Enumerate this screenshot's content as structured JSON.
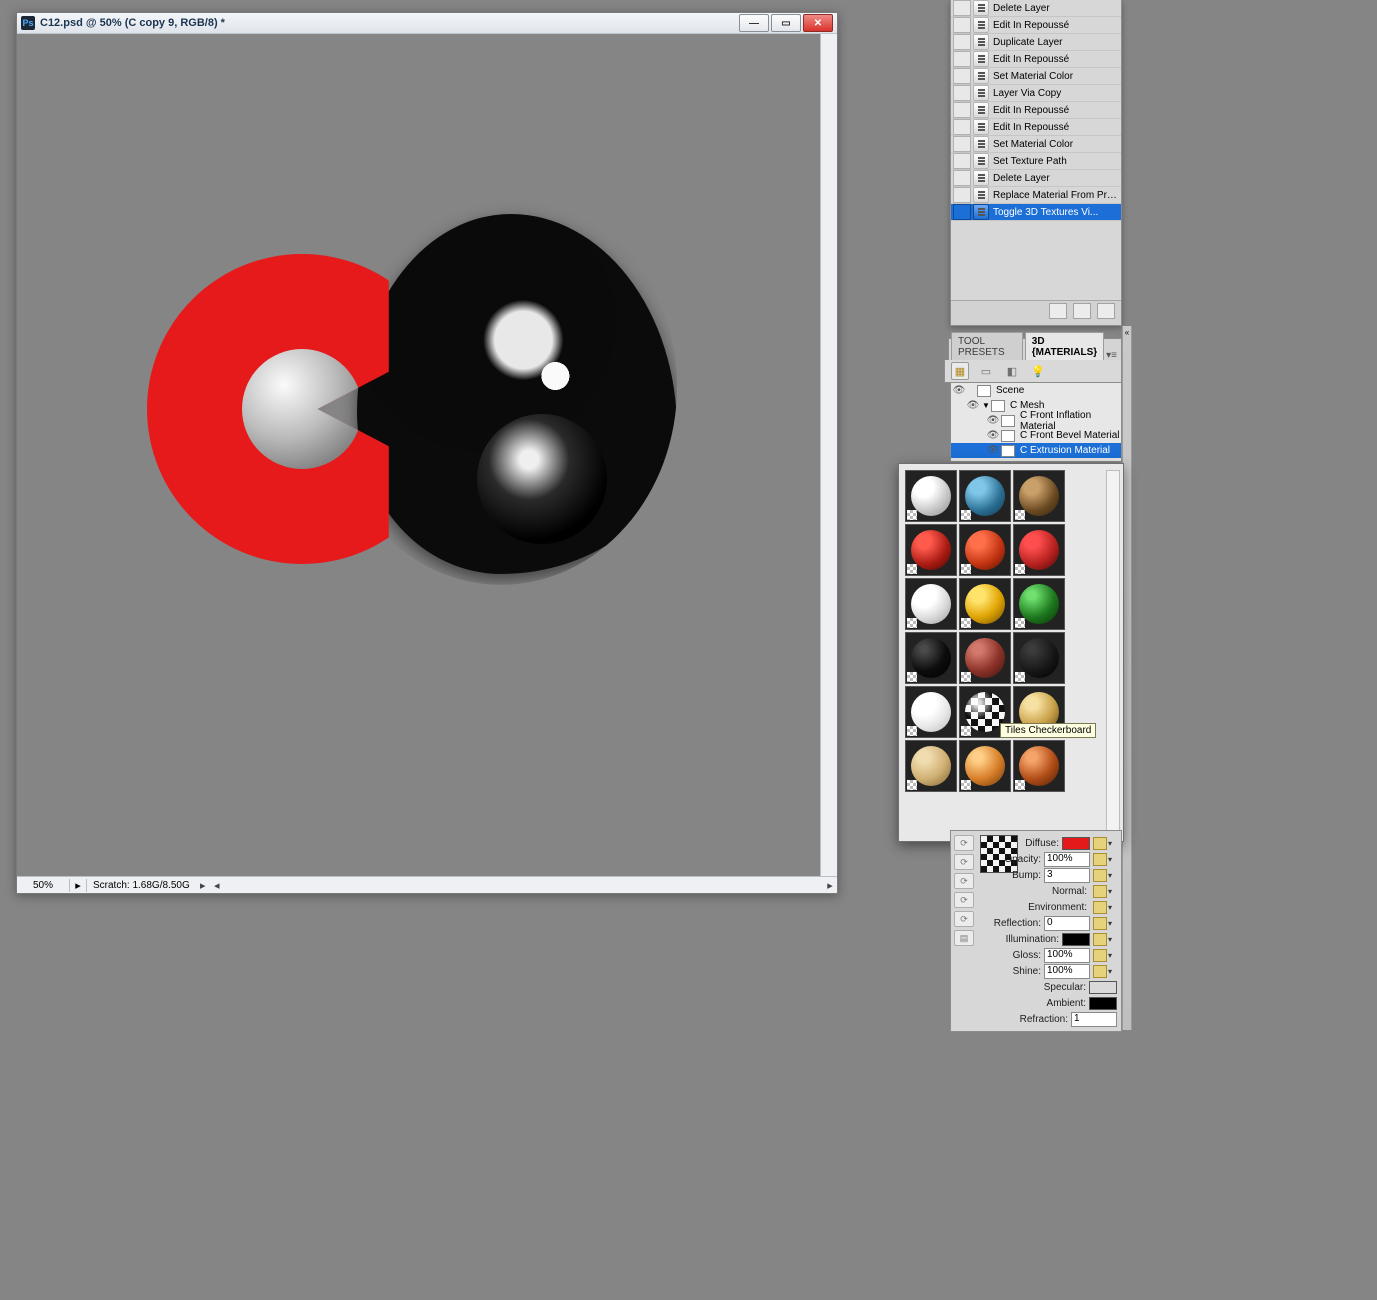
{
  "document": {
    "title": "C12.psd @ 50% (C copy 9, RGB/8) *",
    "zoom": "50%",
    "scratch": "Scratch: 1.68G/8.50G"
  },
  "history": {
    "items": [
      {
        "label": "Delete Layer"
      },
      {
        "label": "Edit In Repoussé"
      },
      {
        "label": "Duplicate Layer"
      },
      {
        "label": "Edit In Repoussé"
      },
      {
        "label": "Set Material Color"
      },
      {
        "label": "Layer Via Copy"
      },
      {
        "label": "Edit In Repoussé"
      },
      {
        "label": "Edit In Repoussé"
      },
      {
        "label": "Set Material Color"
      },
      {
        "label": "Set Texture Path"
      },
      {
        "label": "Delete Layer"
      },
      {
        "label": "Replace Material From Preset"
      },
      {
        "label": "Toggle 3D Textures Vi...",
        "selected": true
      }
    ]
  },
  "tabs": {
    "tool_presets": "TOOL PRESETS",
    "materials": "3D {MATERIALS}"
  },
  "scene": {
    "root": "Scene",
    "mesh": "C Mesh",
    "mats": [
      {
        "label": "C Front Inflation Material"
      },
      {
        "label": "C Front Bevel Material"
      },
      {
        "label": "C Extrusion Material",
        "selected": true
      }
    ]
  },
  "picker": {
    "tooltip": "Tiles Checkerboard"
  },
  "props": {
    "diffuse": "Diffuse:",
    "opacity_l": "Opacity:",
    "opacity_v": "100%",
    "bump_l": "Bump:",
    "bump_v": "3",
    "normal": "Normal:",
    "environment": "Environment:",
    "reflection_l": "Reflection:",
    "reflection_v": "0",
    "illumination": "Illumination:",
    "gloss_l": "Gloss:",
    "gloss_v": "100%",
    "shine_l": "Shine:",
    "shine_v": "100%",
    "specular": "Specular:",
    "ambient": "Ambient:",
    "refraction_l": "Refraction:",
    "refraction_v": "1"
  }
}
